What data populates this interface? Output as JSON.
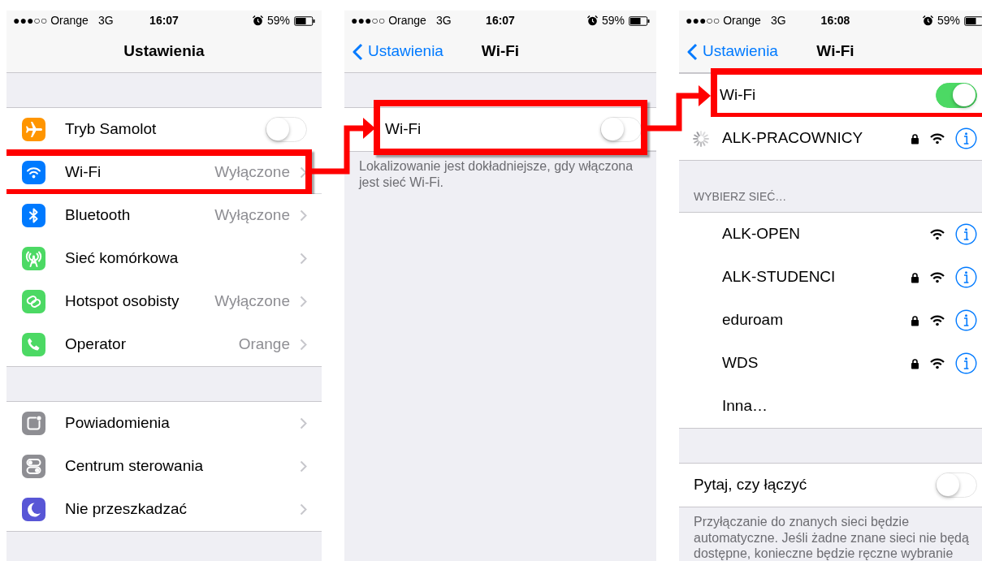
{
  "screens": [
    {
      "status_bar": {
        "carrier": "●●●○○ Orange",
        "network": "3G",
        "time": "16:07",
        "battery": "59%"
      },
      "nav": {
        "title": "Ustawienia"
      },
      "sections": [
        {
          "rows": [
            {
              "kind": "toggle",
              "label": "Tryb Samolot",
              "on": false,
              "highlighted": false,
              "color": "#ff9500"
            },
            {
              "kind": "link",
              "label": "Wi-Fi",
              "value": "Wyłączone",
              "highlighted": true,
              "color": "#007aff"
            },
            {
              "kind": "link",
              "label": "Bluetooth",
              "value": "Wyłączone",
              "highlighted": false,
              "color": "#007aff"
            },
            {
              "kind": "link",
              "label": "Sieć komórkowa",
              "highlighted": false,
              "color": "#4cd964"
            },
            {
              "kind": "link",
              "label": "Hotspot osobisty",
              "value": "Wyłączone",
              "highlighted": false,
              "color": "#4cd964"
            },
            {
              "kind": "link",
              "label": "Operator",
              "value": "Orange",
              "highlighted": false,
              "color": "#4cd964"
            }
          ]
        },
        {
          "rows": [
            {
              "kind": "link",
              "label": "Powiadomienia",
              "highlighted": false,
              "color": "#8e8e93"
            },
            {
              "kind": "link",
              "label": "Centrum sterowania",
              "highlighted": false,
              "color": "#8e8e93"
            },
            {
              "kind": "link",
              "label": "Nie przeszkadzać",
              "highlighted": false,
              "color": "#5856d6"
            }
          ]
        }
      ]
    },
    {
      "status_bar": {
        "carrier": "●●●○○ Orange",
        "network": "3G",
        "time": "16:07",
        "battery": "59%"
      },
      "nav": {
        "back": "Ustawienia",
        "title": "Wi-Fi"
      },
      "sections": [
        {
          "rows": [
            {
              "kind": "toggle",
              "label": "Wi-Fi",
              "on": false,
              "highlighted": true
            }
          ],
          "footer": "Lokalizowanie jest dokładniejsze, gdy włączona jest sieć Wi-Fi."
        }
      ]
    },
    {
      "status_bar": {
        "carrier": "●●●○○ Orange",
        "network": "3G",
        "time": "16:08",
        "battery": "59%"
      },
      "nav": {
        "back": "Ustawienia",
        "title": "Wi-Fi"
      },
      "sections": [
        {
          "rows": [
            {
              "kind": "toggle",
              "label": "Wi-Fi",
              "on": true,
              "highlighted": true
            },
            {
              "kind": "network",
              "label": "ALK-PRACOWNICY",
              "connecting": true,
              "secured": true,
              "highlighted": false
            }
          ]
        },
        {
          "header": "WYBIERZ SIEĆ…",
          "rows": [
            {
              "kind": "network",
              "label": "ALK-OPEN",
              "connecting": false,
              "secured": false,
              "highlighted": false
            },
            {
              "kind": "network",
              "label": "ALK-STUDENCI",
              "connecting": false,
              "secured": true,
              "highlighted": false
            },
            {
              "kind": "network",
              "label": "eduroam",
              "connecting": false,
              "secured": true,
              "highlighted": false
            },
            {
              "kind": "network",
              "label": "WDS",
              "connecting": false,
              "secured": true,
              "highlighted": false
            },
            {
              "kind": "other",
              "label": "Inna…",
              "highlighted": false
            }
          ]
        },
        {
          "rows": [
            {
              "kind": "toggle",
              "label": "Pytaj, czy łączyć",
              "on": false,
              "highlighted": false
            }
          ],
          "footer": "Przyłączanie do znanych sieci będzie automatyczne. Jeśli żadne znane sieci nie będą dostępne, konieczne będzie ręczne wybranie"
        }
      ]
    }
  ]
}
